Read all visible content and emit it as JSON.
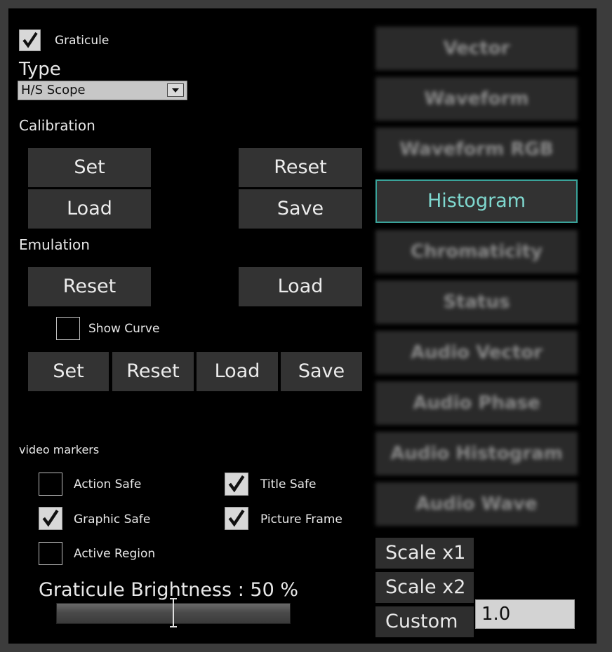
{
  "graticule": {
    "label": "Graticule",
    "checked": true
  },
  "type": {
    "label": "Type",
    "selected": "H/S Scope"
  },
  "calibration": {
    "label": "Calibration",
    "set": "Set",
    "reset": "Reset",
    "load": "Load",
    "save": "Save"
  },
  "emulation": {
    "label": "Emulation",
    "reset": "Reset",
    "load": "Load",
    "show_curve_label": "Show Curve",
    "show_curve_checked": false,
    "set": "Set",
    "reset2": "Reset",
    "load2": "Load",
    "save": "Save"
  },
  "video_markers": {
    "label": "video markers",
    "action_safe": {
      "label": "Action Safe",
      "checked": false
    },
    "title_safe": {
      "label": "Title Safe",
      "checked": true
    },
    "graphic_safe": {
      "label": "Graphic Safe",
      "checked": true
    },
    "picture_frame": {
      "label": "Picture Frame",
      "checked": true
    },
    "active_region": {
      "label": "Active Region",
      "checked": false
    }
  },
  "brightness": {
    "label": "Graticule Brightness : 50 %",
    "value_percent": 50
  },
  "modes": [
    "Vector",
    "Waveform",
    "Waveform RGB",
    "Histogram",
    "Chromaticity",
    "Status",
    "Audio Vector",
    "Audio Phase",
    "Audio Histogram",
    "Audio Wave"
  ],
  "active_mode": "Histogram",
  "scale": {
    "x1": "Scale x1",
    "x2": "Scale x2",
    "custom": "Custom",
    "custom_value": "1.0"
  },
  "colors": {
    "accent": "#3aa39a",
    "button": "#333333",
    "panel": "#000000"
  }
}
